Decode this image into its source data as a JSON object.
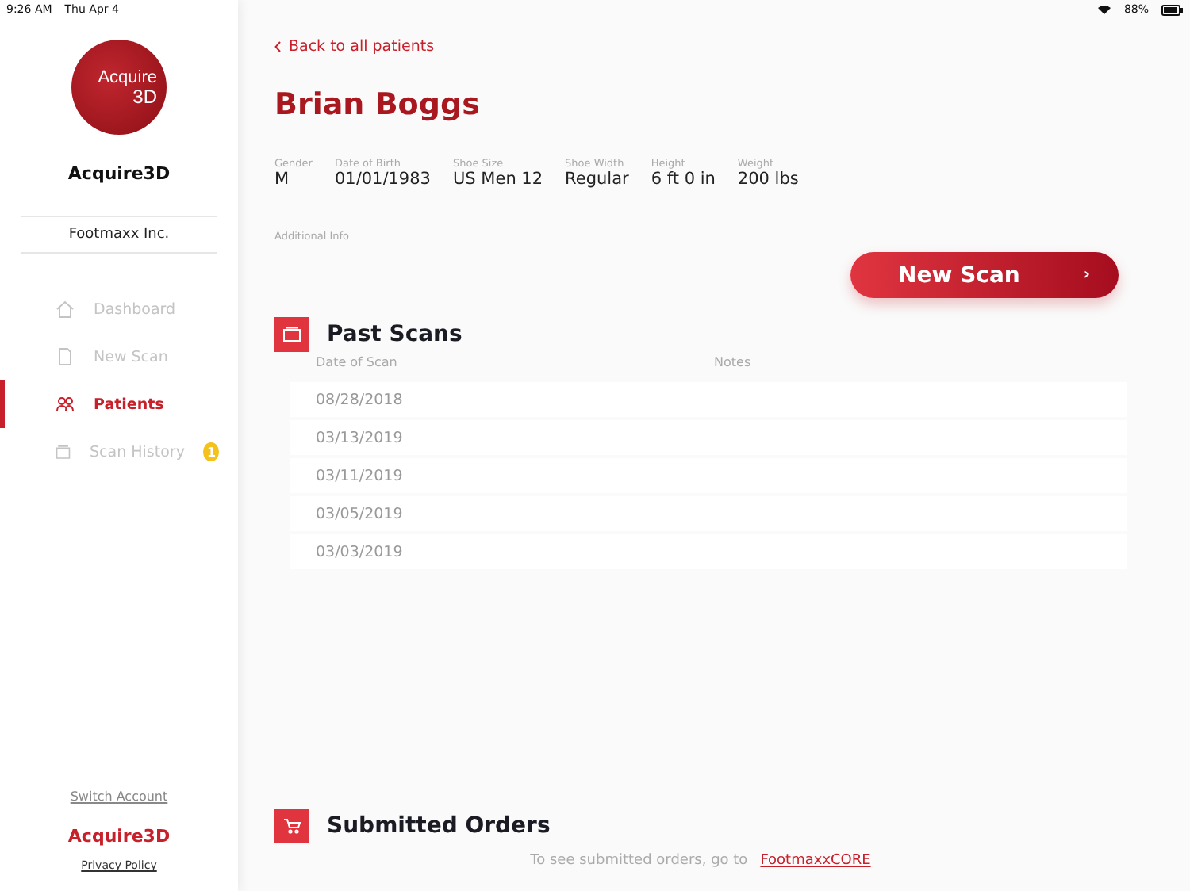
{
  "status_bar": {
    "time": "9:26 AM",
    "date": "Thu Apr 4",
    "battery": "88%"
  },
  "sidebar": {
    "logo": [
      "Acquire",
      "3D"
    ],
    "app_name": "Acquire3D",
    "organization": "Footmaxx Inc.",
    "items": [
      {
        "label": "Dashboard",
        "kind": "home",
        "selected": false
      },
      {
        "label": "New Scan",
        "kind": "document",
        "selected": false
      },
      {
        "label": "Patients",
        "kind": "people",
        "selected": true
      },
      {
        "label": "Scan History",
        "kind": "folder",
        "selected": false,
        "badge": "1"
      }
    ],
    "switch_account": "Switch Account",
    "footer_brand": "Acquire3D",
    "privacy_policy": "Privacy Policy"
  },
  "back_link": "Back to all patients",
  "patient": {
    "name": "Brian Boggs",
    "fields": [
      {
        "label": "Gender",
        "value": "M"
      },
      {
        "label": "Date of Birth",
        "value": "01/01/1983"
      },
      {
        "label": "Shoe Size",
        "value": "US Men 12"
      },
      {
        "label": "Shoe Width",
        "value": "Regular"
      },
      {
        "label": "Height",
        "value": "6 ft 0 in"
      },
      {
        "label": "Weight",
        "value": "200 lbs"
      }
    ],
    "additional_info_label": "Additional Info"
  },
  "new_scan_button": {
    "label": "New Scan",
    "arrow": "›"
  },
  "past_scans": {
    "title": "Past Scans",
    "columns": [
      "Date of Scan",
      "Notes"
    ],
    "rows": [
      {
        "date": "08/28/2018"
      },
      {
        "date": "03/13/2019"
      },
      {
        "date": "03/11/2019"
      },
      {
        "date": "03/05/2019"
      },
      {
        "date": "03/03/2019"
      }
    ]
  },
  "submitted_orders": {
    "title": "Submitted Orders",
    "message": "To see submitted orders, go to",
    "link": "FootmaxxCORE"
  }
}
